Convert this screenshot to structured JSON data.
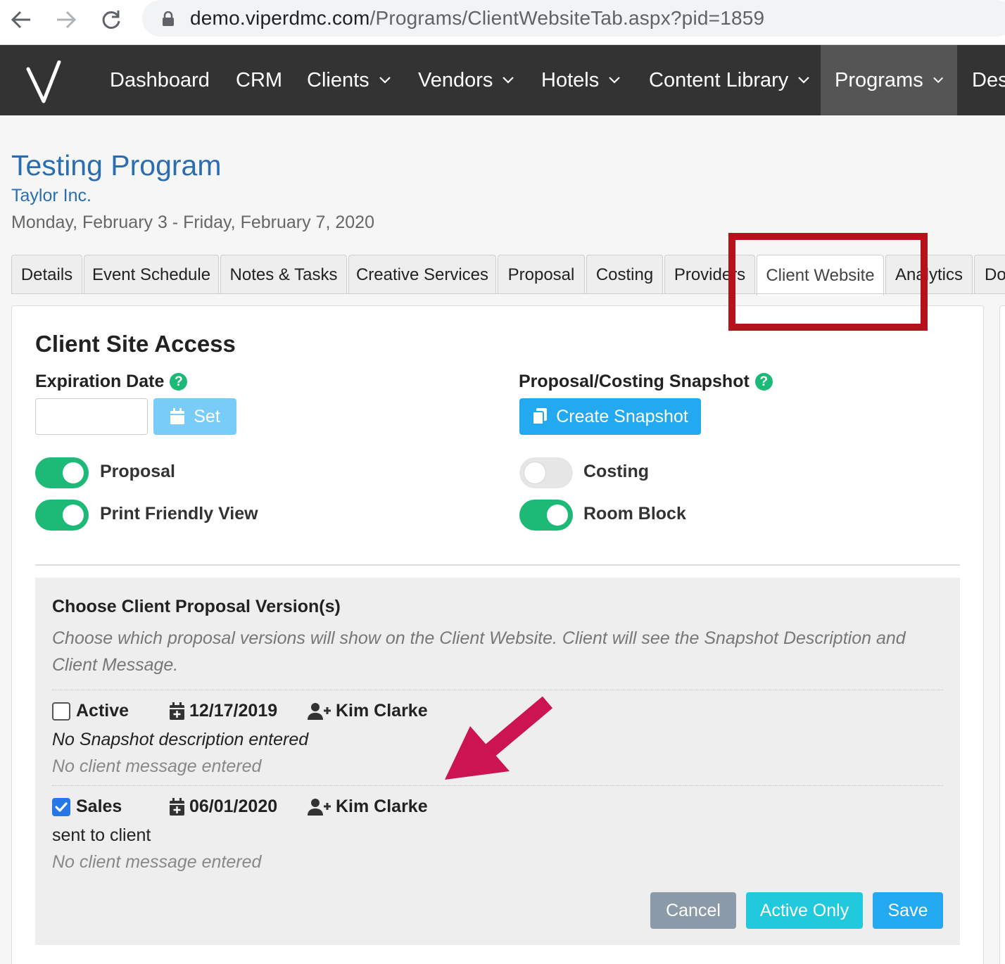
{
  "browser": {
    "url_host": "demo.viperdmc.com",
    "url_path": "/Programs/ClientWebsiteTab.aspx?pid=1859"
  },
  "nav": {
    "logo": "V",
    "items": [
      "Dashboard",
      "CRM",
      "Clients",
      "Vendors",
      "Hotels",
      "Content Library",
      "Programs",
      "Des"
    ]
  },
  "program": {
    "title": "Testing Program",
    "client": "Taylor Inc.",
    "dates": "Monday, February 3 - Friday, February 7, 2020"
  },
  "tabs": [
    "Details",
    "Event Schedule",
    "Notes & Tasks",
    "Creative Services",
    "Proposal",
    "Costing",
    "Providers",
    "Client Website",
    "Analytics",
    "Do"
  ],
  "active_tab": "Client Website",
  "access": {
    "heading": "Client Site Access",
    "expiration_label": "Expiration Date",
    "expiration_value": "",
    "set_label": "Set",
    "snapshot_label": "Proposal/Costing Snapshot",
    "create_snapshot_label": "Create Snapshot",
    "help_glyph": "?",
    "toggles": {
      "proposal": {
        "label": "Proposal",
        "on": true
      },
      "print_friendly": {
        "label": "Print Friendly View",
        "on": true
      },
      "costing": {
        "label": "Costing",
        "on": false
      },
      "room_block": {
        "label": "Room Block",
        "on": true
      }
    }
  },
  "versions": {
    "title": "Choose Client Proposal Version(s)",
    "description": "Choose which proposal versions will show on the Client Website. Client will see the Snapshot Description and Client Message.",
    "items": [
      {
        "name": "Active",
        "checked": false,
        "date": "12/17/2019",
        "user": "Kim Clarke",
        "description": "No Snapshot description entered",
        "message": "No client message entered"
      },
      {
        "name": "Sales",
        "checked": true,
        "date": "06/01/2020",
        "user": "Kim Clarke",
        "description": "sent to client",
        "message": "No client message entered"
      }
    ]
  },
  "buttons": {
    "cancel": "Cancel",
    "active_only": "Active Only",
    "save": "Save"
  },
  "colors": {
    "nav_bg": "#333333",
    "link_blue": "#2a6db0",
    "toggle_on": "#1cb977",
    "primary": "#22a9ef",
    "annotation_red": "#b5121b",
    "annotation_arrow": "#cc1452"
  }
}
